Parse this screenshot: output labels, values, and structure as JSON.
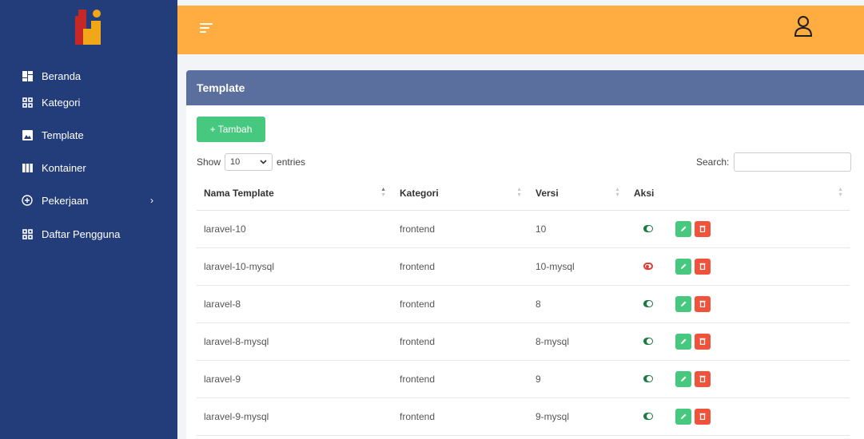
{
  "sidebar": {
    "items": [
      {
        "label": "Beranda",
        "icon": "dashboard-icon"
      },
      {
        "label": "Kategori",
        "icon": "grid-icon"
      },
      {
        "label": "Template",
        "icon": "image-icon"
      },
      {
        "label": "Kontainer",
        "icon": "columns-icon"
      },
      {
        "label": "Pekerjaan",
        "icon": "plus-circle-icon",
        "chevron": "›"
      },
      {
        "label": "Daftar Pengguna",
        "icon": "grid-icon"
      }
    ]
  },
  "card": {
    "title": "Template",
    "add_label": "+ Tambah",
    "show_label": "Show",
    "entries_value": "10",
    "entries_label": "entries",
    "search_label": "Search:",
    "search_value": ""
  },
  "table": {
    "headers": [
      "Nama Template",
      "Kategori",
      "Versi",
      "Aksi"
    ],
    "rows": [
      {
        "name": "laravel-10",
        "kategori": "frontend",
        "versi": "10",
        "active": true
      },
      {
        "name": "laravel-10-mysql",
        "kategori": "frontend",
        "versi": "10-mysql",
        "active": false
      },
      {
        "name": "laravel-8",
        "kategori": "frontend",
        "versi": "8",
        "active": true
      },
      {
        "name": "laravel-8-mysql",
        "kategori": "frontend",
        "versi": "8-mysql",
        "active": true
      },
      {
        "name": "laravel-9",
        "kategori": "frontend",
        "versi": "9",
        "active": true
      },
      {
        "name": "laravel-9-mysql",
        "kategori": "frontend",
        "versi": "9-mysql",
        "active": true
      }
    ]
  },
  "colors": {
    "sidebar": "#233d7b",
    "topbar": "#ffac41",
    "card_header": "#5b6f9f",
    "success": "#46c97e",
    "danger": "#f0533c"
  }
}
